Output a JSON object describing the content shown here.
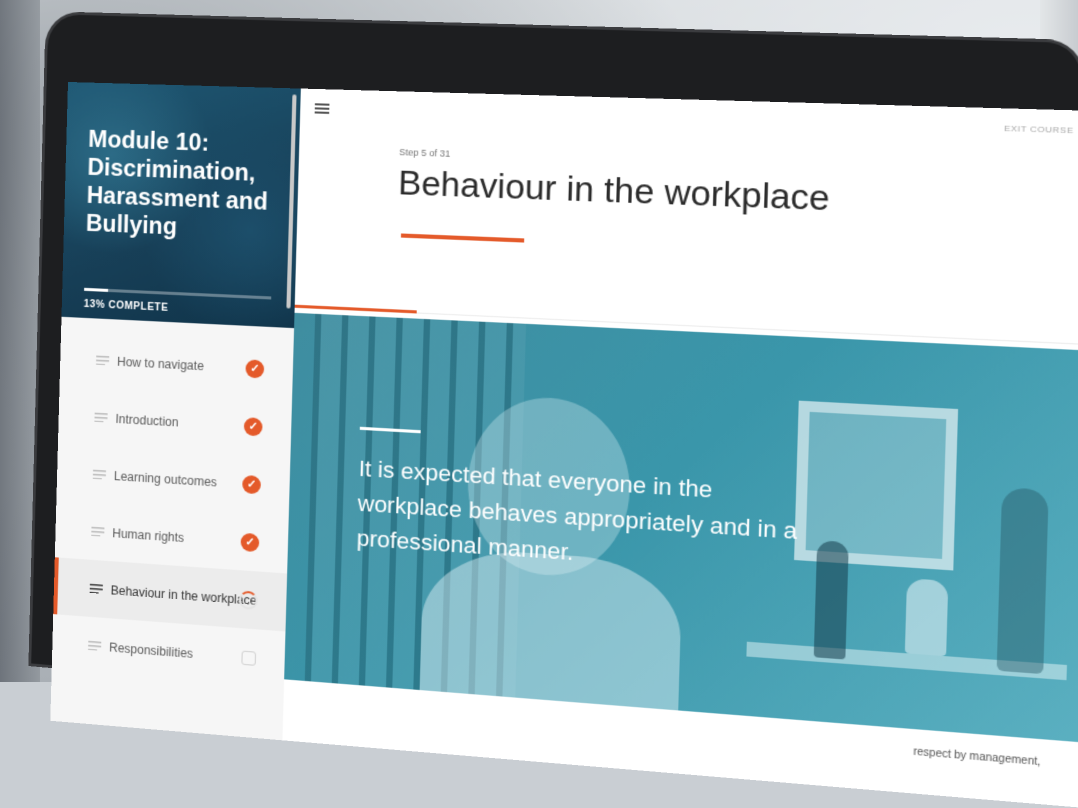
{
  "sidebar": {
    "module_title": "Module 10: Discrimination, Harassment and Bullying",
    "progress_label": "13% COMPLETE",
    "progress_fraction": 0.13,
    "items": [
      {
        "label": "How to navigate",
        "status": "complete",
        "status_icon": "check-icon"
      },
      {
        "label": "Introduction",
        "status": "complete",
        "status_icon": "check-icon"
      },
      {
        "label": "Learning outcomes",
        "status": "complete",
        "status_icon": "check-icon"
      },
      {
        "label": "Human rights",
        "status": "complete",
        "status_icon": "check-icon"
      },
      {
        "label": "Behaviour in the workplace",
        "status": "in-progress",
        "status_icon": "partial-circle-icon"
      },
      {
        "label": "Responsibilities",
        "status": "not-started",
        "status_icon": "empty-box-icon"
      }
    ]
  },
  "header": {
    "menu_icon": "hamburger-menu-icon",
    "exit_label": "EXIT COURSE",
    "step_label": "Step 5 of 31",
    "lesson_progress_fraction": 0.16
  },
  "lesson": {
    "title": "Behaviour in the workplace",
    "quote": "It is expected that everyone in the workplace behaves appropriately and in a professional manner.",
    "partial_body_text": "respect by management,"
  },
  "colors": {
    "accent": "#e45a2a",
    "sidebar_header": "#1e5773",
    "hero_tint": "#3a96aa"
  }
}
